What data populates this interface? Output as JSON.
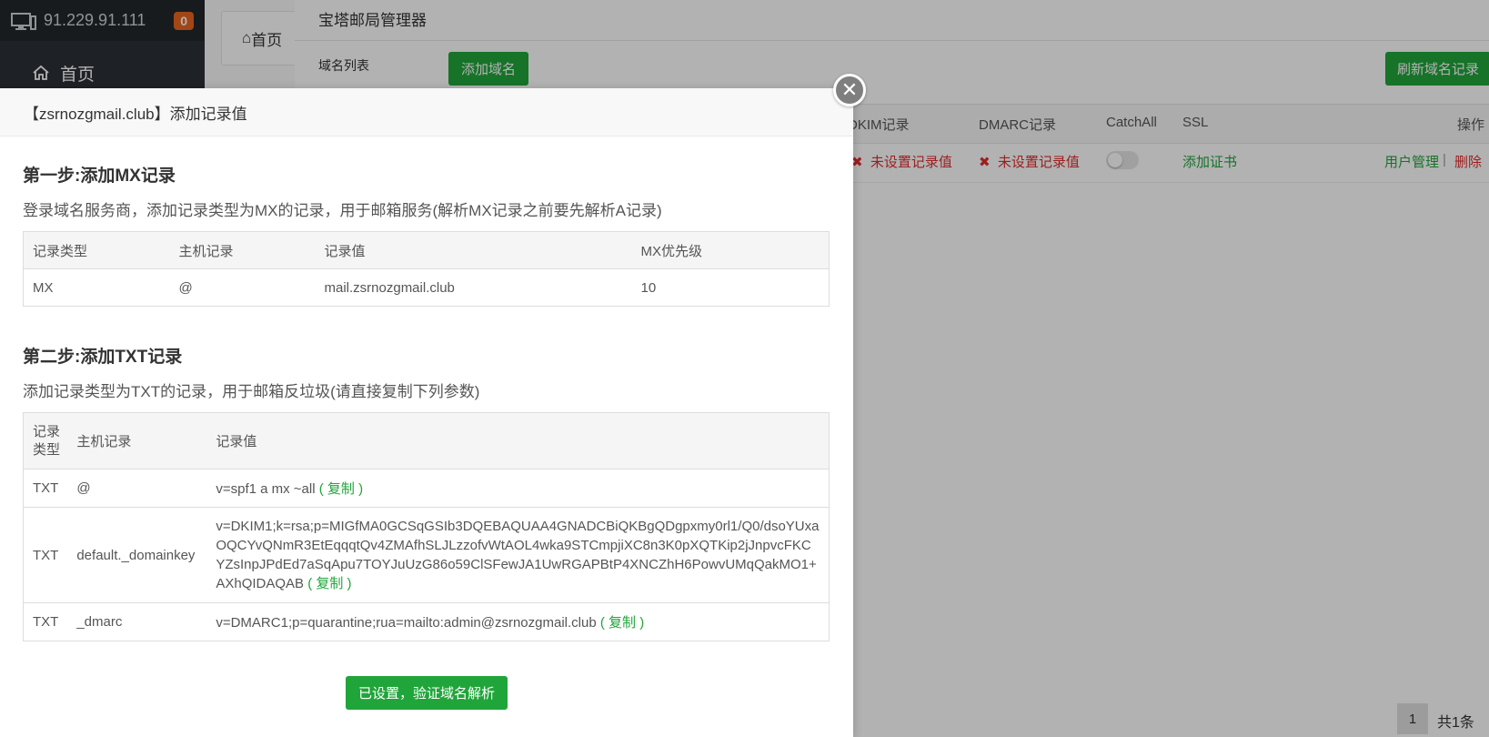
{
  "sidebar": {
    "ip": "91.229.91.111",
    "badge": "0",
    "home_label": "首页"
  },
  "topbar": {
    "home_tab": "首页"
  },
  "panel": {
    "title": "宝塔邮局管理器",
    "domain_list_label": "域名列表",
    "add_domain_button": "添加域名",
    "refresh_button": "刷新域名记录",
    "columns": {
      "dkim": "DKIM记录",
      "dmarc": "DMARC记录",
      "catchall": "CatchAll",
      "ssl": "SSL",
      "actions": "操作"
    },
    "row": {
      "dkim_status": "未设置记录值",
      "dmarc_status": "未设置记录值",
      "ssl_action": "添加证书",
      "user_manage": "用户管理",
      "separator": "|",
      "delete": "删除"
    },
    "pager": {
      "page": "1",
      "total": "共1条"
    }
  },
  "modal": {
    "title": "【zsrnozgmail.club】添加记录值",
    "close_symbol": "✕",
    "step1": {
      "title": "第一步:添加MX记录",
      "desc": "登录域名服务商，添加记录类型为MX的记录，用于邮箱服务(解析MX记录之前要先解析A记录)",
      "headers": [
        "记录类型",
        "主机记录",
        "记录值",
        "MX优先级"
      ],
      "rows": [
        [
          "MX",
          "@",
          "mail.zsrnozgmail.club",
          "10"
        ]
      ]
    },
    "step2": {
      "title": "第二步:添加TXT记录",
      "desc": "添加记录类型为TXT的记录，用于邮箱反垃圾(请直接复制下列参数)",
      "headers": [
        "记录类型",
        "主机记录",
        "记录值"
      ],
      "rows": [
        {
          "type": "TXT",
          "host": "@",
          "value": "v=spf1 a mx ~all",
          "copy": "( 复制 )"
        },
        {
          "type": "TXT",
          "host": "default._domainkey",
          "value": "v=DKIM1;k=rsa;p=MIGfMA0GCSqGSIb3DQEBAQUAA4GNADCBiQKBgQDgpxmy0rl1/Q0/dsoYUxaOQCYvQNmR3EtEqqqtQv4ZMAfhSLJLzzofvWtAOL4wka9STCmpjiXC8n3K0pXQTKip2jJnpvcFKCYZsInpJPdEd7aSqApu7TOYJuUzG86o59ClSFewJA1UwRGAPBtP4XNCZhH6PowvUMqQakMO1+AXhQIDAQAB",
          "copy": "( 复制 )"
        },
        {
          "type": "TXT",
          "host": "_dmarc",
          "value": "v=DMARC1;p=quarantine;rua=mailto:admin@zsrnozgmail.club",
          "copy": "( 复制 )"
        }
      ]
    },
    "verify_button": "已设置，验证域名解析"
  },
  "colors": {
    "accent_green": "#20a53a",
    "error_red": "#e02d2d",
    "sidebar_bg": "#2b3036",
    "badge_orange": "#e8651f"
  }
}
